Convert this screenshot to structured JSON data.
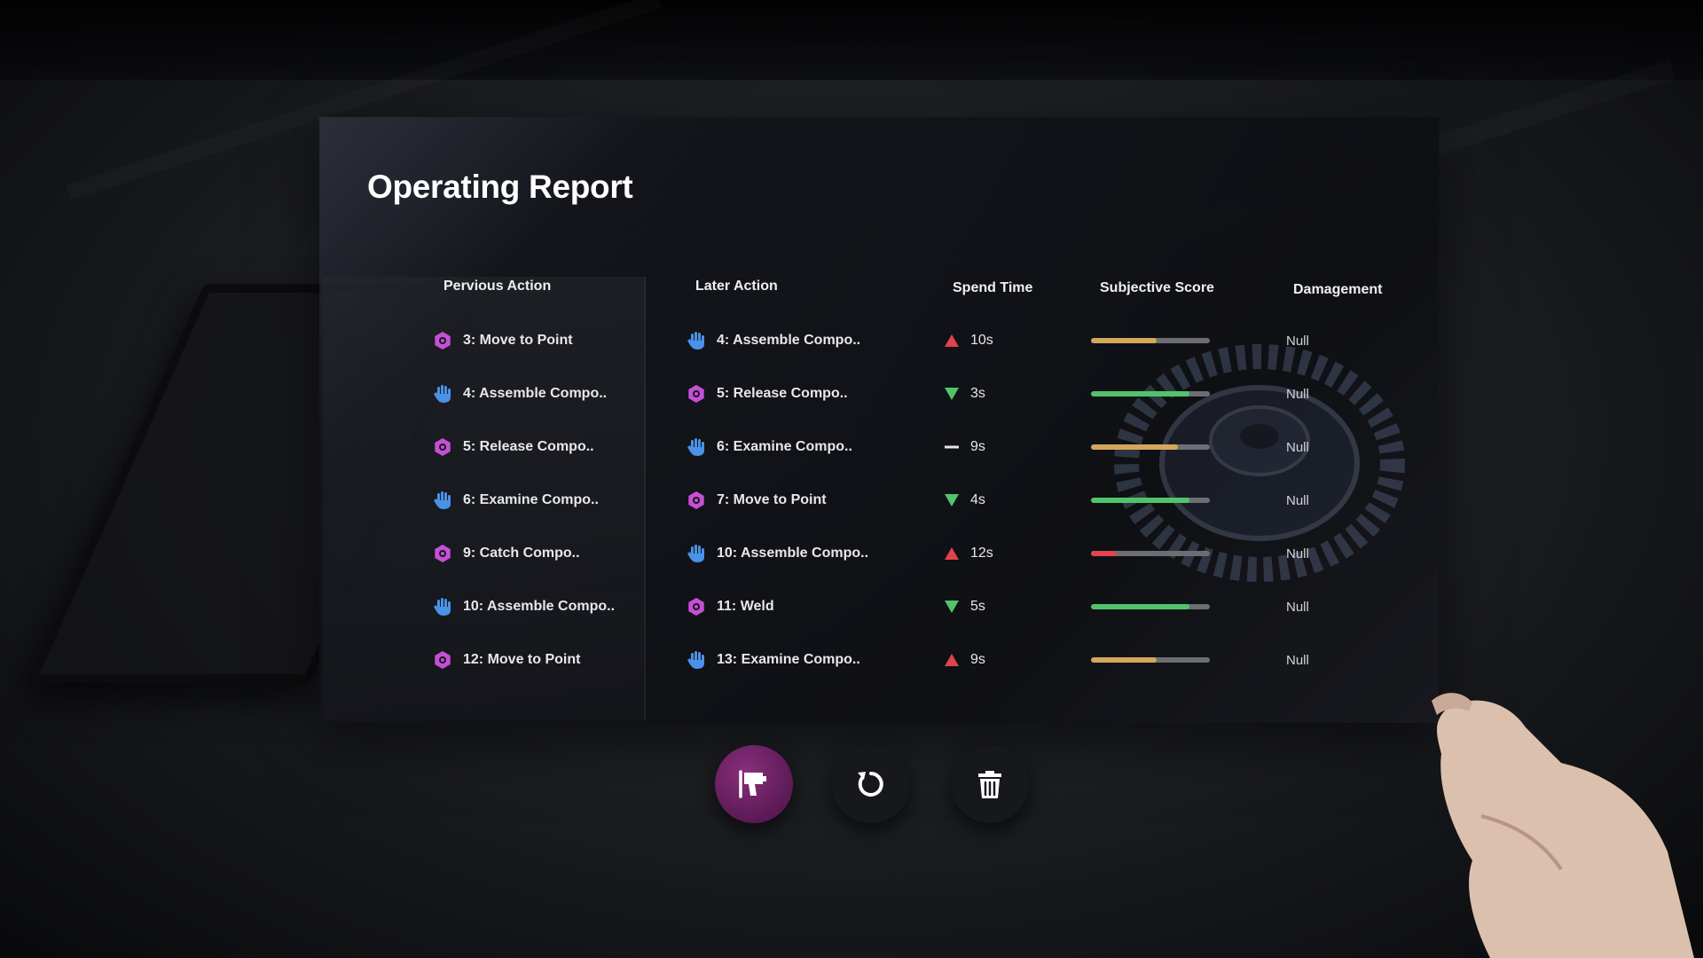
{
  "panel": {
    "title": "Operating Report"
  },
  "headers": {
    "previous": "Pervious Action",
    "later": "Later Action",
    "spend_time": "Spend Time",
    "score": "Subjective Score",
    "damage": "Damagement"
  },
  "rows": [
    {
      "prev": {
        "label": "3: Move to Point",
        "icon": "gear-icon"
      },
      "later": {
        "label": "4: Assemble Compo..",
        "icon": "hand-icon"
      },
      "time": "10s",
      "trend": "up",
      "score": 0.55,
      "score_color": "#d3a85a",
      "damage": "Null"
    },
    {
      "prev": {
        "label": "4: Assemble Compo..",
        "icon": "hand-icon"
      },
      "later": {
        "label": "5: Release Compo..",
        "icon": "gear-icon"
      },
      "time": "3s",
      "trend": "down",
      "score": 0.83,
      "score_color": "#4fc46a",
      "damage": "Null"
    },
    {
      "prev": {
        "label": "5: Release Compo..",
        "icon": "gear-icon"
      },
      "later": {
        "label": "6: Examine Compo..",
        "icon": "hand-icon"
      },
      "time": "9s",
      "trend": "flat",
      "score": 0.73,
      "score_color": "#d3a85a",
      "damage": "Null"
    },
    {
      "prev": {
        "label": "6: Examine Compo..",
        "icon": "hand-icon"
      },
      "later": {
        "label": "7: Move to Point",
        "icon": "gear-icon"
      },
      "time": "4s",
      "trend": "down",
      "score": 0.83,
      "score_color": "#4fc46a",
      "damage": "Null"
    },
    {
      "prev": {
        "label": "9: Catch Compo..",
        "icon": "gear-icon"
      },
      "later": {
        "label": "10: Assemble Compo..",
        "icon": "hand-icon"
      },
      "time": "12s",
      "trend": "up",
      "score": 0.22,
      "score_color": "#e0454a",
      "damage": "Null"
    },
    {
      "prev": {
        "label": "10: Assemble Compo..",
        "icon": "hand-icon"
      },
      "later": {
        "label": "11: Weld",
        "icon": "gear-icon"
      },
      "time": "5s",
      "trend": "down",
      "score": 0.83,
      "score_color": "#4fc46a",
      "damage": "Null"
    },
    {
      "prev": {
        "label": "12: Move to Point",
        "icon": "gear-icon"
      },
      "later": {
        "label": "13: Examine Compo..",
        "icon": "hand-icon"
      },
      "time": "9s",
      "trend": "up",
      "score": 0.55,
      "score_color": "#d3a85a",
      "damage": "Null"
    }
  ],
  "colors": {
    "gear": "#c550d6",
    "hand": "#4a92e8",
    "trend_up": "#e0454a",
    "trend_down": "#4fc46a",
    "trend_flat": "#e6e6e6",
    "accent_button": "#7a2a70"
  },
  "buttons": [
    {
      "name": "drill-tool-button",
      "icon": "drill-icon",
      "active": true
    },
    {
      "name": "reset-button",
      "icon": "rotate-ccw-icon",
      "active": false
    },
    {
      "name": "delete-button",
      "icon": "trash-icon",
      "active": false
    }
  ]
}
